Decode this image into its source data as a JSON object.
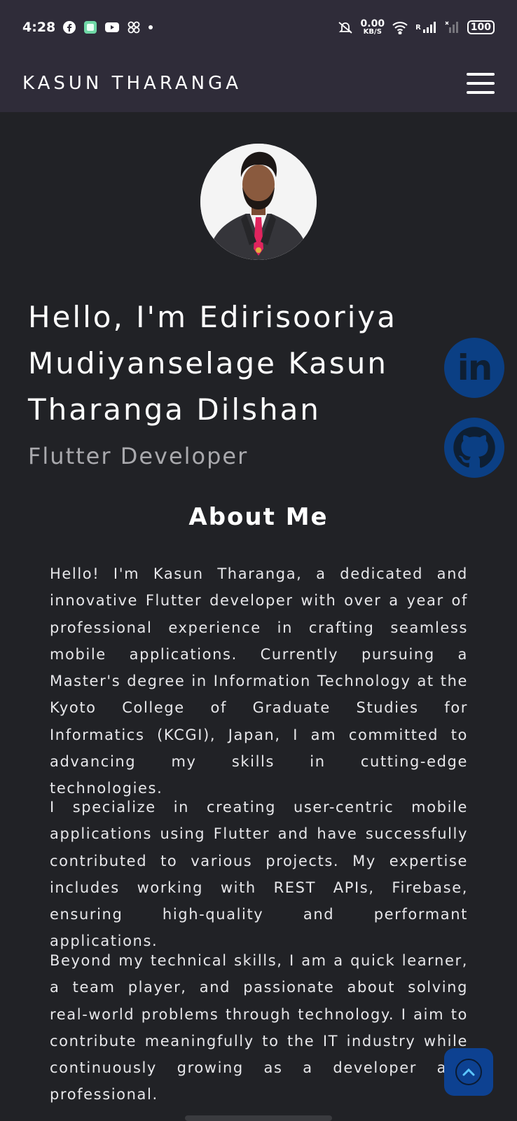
{
  "status_bar": {
    "time": "4:28",
    "net_speed_value": "0.00",
    "net_speed_unit": "KB/S",
    "signal_label": "R",
    "battery": "100",
    "icons": [
      "facebook-icon",
      "chat-icon",
      "youtube-icon",
      "apps-icon",
      "mute-icon",
      "wifi-icon",
      "signal-icon",
      "battery-icon"
    ]
  },
  "header": {
    "title": "KASUN THARANGA",
    "menu_icon": "hamburger-menu-icon"
  },
  "hero": {
    "greeting": "Hello, I'm Edirisooriya Mudiyanselage Kasun Tharanga Dilshan",
    "role": "Flutter Developer"
  },
  "social": {
    "linkedin_label": "in",
    "github_icon": "github-icon"
  },
  "about": {
    "heading": "About Me",
    "paragraphs": [
      "Hello! I'm Kasun Tharanga, a dedicated and innovative Flutter developer with over a year of professional experience in crafting seamless mobile applications. Currently pursuing a Master's degree in Information Technology at the Kyoto College of Graduate Studies for Informatics (KCGI), Japan, I am committed to advancing my skills in cutting-edge technologies.",
      "I specialize in creating user-centric mobile applications using Flutter and have successfully contributed to various projects. My expertise includes working with REST APIs, Firebase, ensuring high-quality and performant applications.",
      "Beyond my technical skills, I am a quick learner, a team player, and passionate about solving real-world problems through technology. I aim to contribute meaningfully to the IT industry while continuously growing as a developer and professional."
    ]
  },
  "colors": {
    "background": "#212226",
    "header": "#2f2c39",
    "social_button": "#0b3f84",
    "scroll_button": "#0d4191"
  }
}
